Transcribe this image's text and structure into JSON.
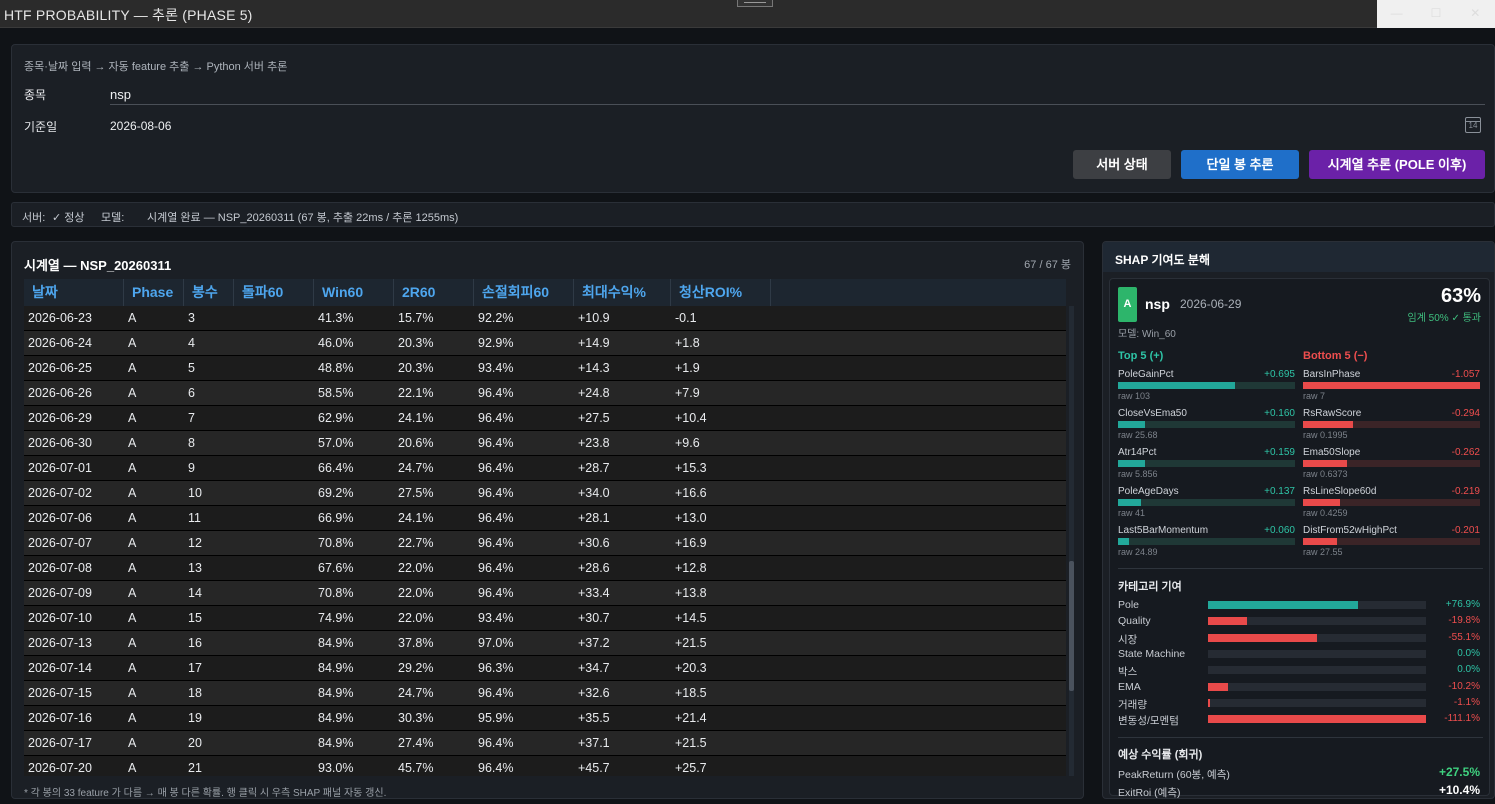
{
  "window": {
    "title": "HTF PROBABILITY — 추론 (PHASE 5)"
  },
  "input": {
    "breadcrumb": "종목·날짜 입력 → 자동 feature 추출 → Python 서버 추론",
    "symbol_label": "종목",
    "symbol_value": "nsp",
    "date_label": "기준일",
    "date_value": "2026-08-06",
    "calendar_icon_text": "14",
    "buttons": {
      "status": "서버 상태",
      "single": "단일 봉 추론",
      "timeseries": "시계열 추론 (POLE 이후)"
    }
  },
  "status": {
    "server_label": "서버:",
    "server_value": "✓ 정상",
    "model_label": "모델:",
    "message": "시계열 완료 — NSP_20260311 (67 봉, 추출 22ms / 추론 1255ms)"
  },
  "table": {
    "title": "시계열 —  NSP_20260311",
    "count": "67  /  67  봉",
    "columns": [
      "날짜",
      "Phase",
      "봉수",
      "돌파60",
      "Win60",
      "2R60",
      "손절회피60",
      "최대수익%",
      "청산ROI%"
    ],
    "rows": [
      [
        "2026-06-23",
        "A",
        "3",
        "",
        "41.3%",
        "15.7%",
        "92.2%",
        "+10.9",
        "-0.1"
      ],
      [
        "2026-06-24",
        "A",
        "4",
        "",
        "46.0%",
        "20.3%",
        "92.9%",
        "+14.9",
        "+1.8"
      ],
      [
        "2026-06-25",
        "A",
        "5",
        "",
        "48.8%",
        "20.3%",
        "93.4%",
        "+14.3",
        "+1.9"
      ],
      [
        "2026-06-26",
        "A",
        "6",
        "",
        "58.5%",
        "22.1%",
        "96.4%",
        "+24.8",
        "+7.9"
      ],
      [
        "2026-06-29",
        "A",
        "7",
        "",
        "62.9%",
        "24.1%",
        "96.4%",
        "+27.5",
        "+10.4"
      ],
      [
        "2026-06-30",
        "A",
        "8",
        "",
        "57.0%",
        "20.6%",
        "96.4%",
        "+23.8",
        "+9.6"
      ],
      [
        "2026-07-01",
        "A",
        "9",
        "",
        "66.4%",
        "24.7%",
        "96.4%",
        "+28.7",
        "+15.3"
      ],
      [
        "2026-07-02",
        "A",
        "10",
        "",
        "69.2%",
        "27.5%",
        "96.4%",
        "+34.0",
        "+16.6"
      ],
      [
        "2026-07-06",
        "A",
        "11",
        "",
        "66.9%",
        "24.1%",
        "96.4%",
        "+28.1",
        "+13.0"
      ],
      [
        "2026-07-07",
        "A",
        "12",
        "",
        "70.8%",
        "22.7%",
        "96.4%",
        "+30.6",
        "+16.9"
      ],
      [
        "2026-07-08",
        "A",
        "13",
        "",
        "67.6%",
        "22.0%",
        "96.4%",
        "+28.6",
        "+12.8"
      ],
      [
        "2026-07-09",
        "A",
        "14",
        "",
        "70.8%",
        "22.0%",
        "96.4%",
        "+33.4",
        "+13.8"
      ],
      [
        "2026-07-10",
        "A",
        "15",
        "",
        "74.9%",
        "22.0%",
        "93.4%",
        "+30.7",
        "+14.5"
      ],
      [
        "2026-07-13",
        "A",
        "16",
        "",
        "84.9%",
        "37.8%",
        "97.0%",
        "+37.2",
        "+21.5"
      ],
      [
        "2026-07-14",
        "A",
        "17",
        "",
        "84.9%",
        "29.2%",
        "96.3%",
        "+34.7",
        "+20.3"
      ],
      [
        "2026-07-15",
        "A",
        "18",
        "",
        "84.9%",
        "24.7%",
        "96.4%",
        "+32.6",
        "+18.5"
      ],
      [
        "2026-07-16",
        "A",
        "19",
        "",
        "84.9%",
        "30.3%",
        "95.9%",
        "+35.5",
        "+21.4"
      ],
      [
        "2026-07-17",
        "A",
        "20",
        "",
        "84.9%",
        "27.4%",
        "96.4%",
        "+37.1",
        "+21.5"
      ],
      [
        "2026-07-20",
        "A",
        "21",
        "",
        "93.0%",
        "45.7%",
        "96.4%",
        "+45.7",
        "+25.7"
      ]
    ],
    "footnote": "* 각 봉의 33 feature 가 다름 → 매 봉 다른 확률. 행 클릭 시 우측 SHAP 패널 자동 갱신."
  },
  "shap": {
    "title": "SHAP 기여도 분해",
    "phase": "A",
    "ticker": "nsp",
    "date": "2026-06-29",
    "probability": "63%",
    "threshold": "임계 50% ✓ 통과",
    "model": "모델:  Win_60",
    "top_title": "Top 5  (+)",
    "bottom_title": "Bottom 5  (−)",
    "top": [
      {
        "name": "PoleGainPct",
        "value": "+0.695",
        "raw": "raw 103",
        "level": 0.66
      },
      {
        "name": "CloseVsEma50",
        "value": "+0.160",
        "raw": "raw 25.68",
        "level": 0.15
      },
      {
        "name": "Atr14Pct",
        "value": "+0.159",
        "raw": "raw 5.856",
        "level": 0.15
      },
      {
        "name": "PoleAgeDays",
        "value": "+0.137",
        "raw": "raw 41",
        "level": 0.13
      },
      {
        "name": "Last5BarMomentum",
        "value": "+0.060",
        "raw": "raw 24.89",
        "level": 0.06
      }
    ],
    "bottom": [
      {
        "name": "BarsInPhase",
        "value": "-1.057",
        "raw": "raw 7",
        "level": 1.0
      },
      {
        "name": "RsRawScore",
        "value": "-0.294",
        "raw": "raw 0.1995",
        "level": 0.28
      },
      {
        "name": "Ema50Slope",
        "value": "-0.262",
        "raw": "raw 0.6373",
        "level": 0.25
      },
      {
        "name": "RsLineSlope60d",
        "value": "-0.219",
        "raw": "raw 0.4259",
        "level": 0.21
      },
      {
        "name": "DistFrom52wHighPct",
        "value": "-0.201",
        "raw": "raw 27.55",
        "level": 0.19
      }
    ],
    "category_title": "카테고리 기여",
    "categories": [
      {
        "name": "Pole",
        "value": "+76.9%",
        "sign": "pos",
        "level": 0.69
      },
      {
        "name": "Quality",
        "value": "-19.8%",
        "sign": "neg",
        "level": 0.18
      },
      {
        "name": "시장",
        "value": "-55.1%",
        "sign": "neg",
        "level": 0.5
      },
      {
        "name": "State Machine",
        "value": "0.0%",
        "sign": "zero",
        "level": 0
      },
      {
        "name": "박스",
        "value": "0.0%",
        "sign": "zero",
        "level": 0
      },
      {
        "name": "EMA",
        "value": "-10.2%",
        "sign": "neg",
        "level": 0.09
      },
      {
        "name": "거래량",
        "value": "-1.1%",
        "sign": "neg",
        "level": 0.01
      },
      {
        "name": "변동성/모멘텀",
        "value": "-111.1%",
        "sign": "neg",
        "level": 1.0
      }
    ],
    "return_title": "예상 수익률 (회귀)",
    "returns": [
      {
        "name": "PeakReturn (60봉, 예측)",
        "value": "+27.5%",
        "color": "#3fd17f"
      },
      {
        "name": "ExitRoi (예측)",
        "value": "+10.4%",
        "color": "#ffffff"
      }
    ]
  }
}
